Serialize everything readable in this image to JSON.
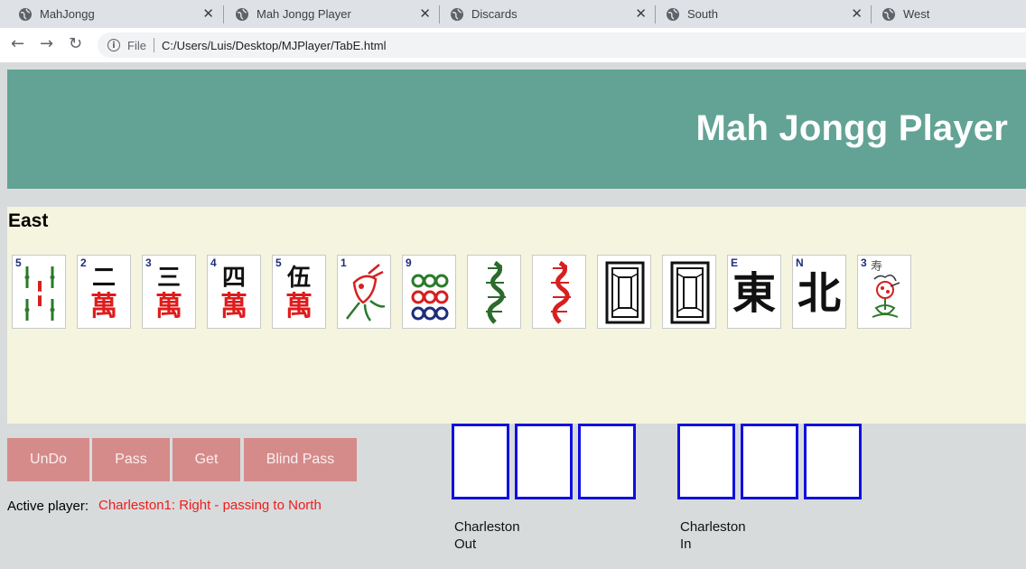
{
  "browser": {
    "tabs": [
      {
        "label": "MahJongg"
      },
      {
        "label": "Mah Jongg Player"
      },
      {
        "label": "Discards"
      },
      {
        "label": "South"
      },
      {
        "label": "West"
      }
    ],
    "close_glyph": "✕",
    "address": {
      "info_glyph": "i",
      "scheme_label": "File",
      "url": "C:/Users/Luis/Desktop/MJPlayer/TabE.html"
    }
  },
  "header": {
    "title": "Mah Jongg Player",
    "background": "#62a395"
  },
  "hand": {
    "title": "East",
    "background": "#f5f5df",
    "tiles": [
      {
        "index": "5",
        "suit": "bamboo",
        "glyph": ""
      },
      {
        "index": "2",
        "suit": "character",
        "glyph": "二"
      },
      {
        "index": "3",
        "suit": "character",
        "glyph": "三"
      },
      {
        "index": "4",
        "suit": "character",
        "glyph": "四"
      },
      {
        "index": "5",
        "suit": "character",
        "glyph": "伍"
      },
      {
        "index": "1",
        "suit": "bamboo-bird",
        "glyph": ""
      },
      {
        "index": "9",
        "suit": "dots",
        "glyph": ""
      },
      {
        "index": "",
        "suit": "green-dragon",
        "glyph": ""
      },
      {
        "index": "",
        "suit": "red-dragon",
        "glyph": ""
      },
      {
        "index": "",
        "suit": "white-dragon",
        "glyph": ""
      },
      {
        "index": "",
        "suit": "white-dragon",
        "glyph": ""
      },
      {
        "index": "E",
        "suit": "wind",
        "glyph": "東"
      },
      {
        "index": "N",
        "suit": "wind",
        "glyph": "北"
      },
      {
        "index": "3",
        "suit": "flower",
        "glyph": "寿"
      }
    ],
    "character_glyph": "萬"
  },
  "controls": {
    "undo": "UnDo",
    "pass": "Pass",
    "get": "Get",
    "blind_pass": "Blind Pass",
    "button_color": "#d58b8a"
  },
  "status": {
    "label": "Active player:",
    "value": "Charleston1:  Right - passing to North",
    "color": "#ee1c1c"
  },
  "charleston": {
    "out_line1": "Charleston",
    "out_line2": "Out",
    "in_line1": "Charleston",
    "in_line2": "In",
    "slot_border_color": "#1010e0"
  }
}
